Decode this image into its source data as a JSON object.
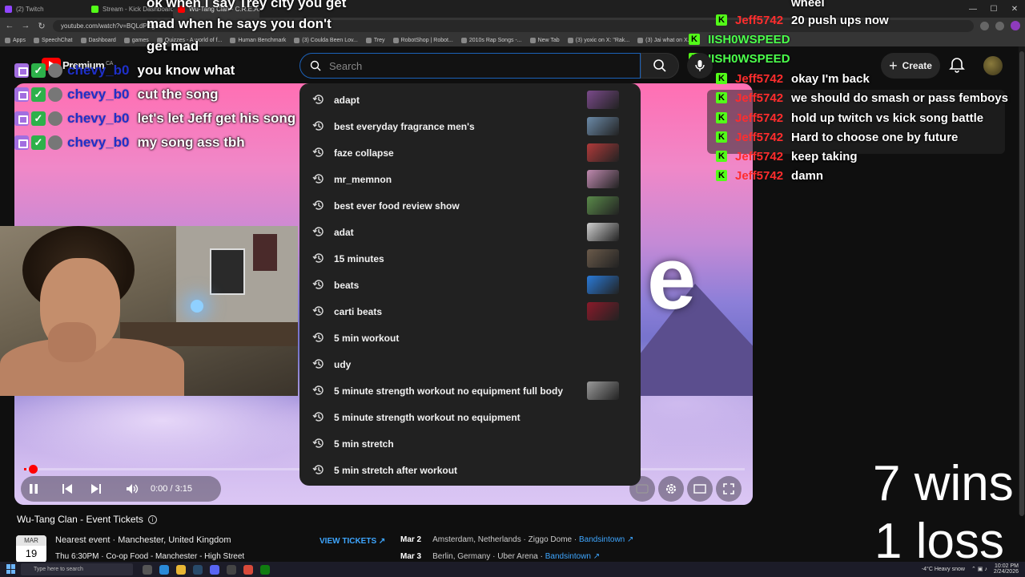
{
  "browser": {
    "tabs": [
      {
        "label": "(2) Twitch",
        "color": "#9146ff"
      },
      {
        "label": "Stream - Kick Dashboard",
        "color": "#53fc18"
      },
      {
        "label": "Wu-Tang Clan - C.R.E.A.M. (Offi",
        "color": "#ff0000",
        "active": true
      }
    ],
    "url": "youtube.com/watch?v=BQLdPEg",
    "bookmarks": [
      "Apps",
      "SpeechChat",
      "Dashboard",
      "games",
      "Quizzes - A world of f...",
      "Human Benchmark",
      "(3) Coulda Been Lov...",
      "Trey",
      "RobotShop | Robot...",
      "2010s Rap Songs -...",
      "New Tab",
      "(3) yoxic on X: \"Rak...",
      "(3) Jai what on X..."
    ]
  },
  "youtube": {
    "brand": "Premium",
    "region": "CA",
    "search_placeholder": "Search",
    "create_label": "Create",
    "suggestions": [
      {
        "text": "adapt",
        "thumb": "#7a4a8a"
      },
      {
        "text": "best everyday fragrance men's",
        "thumb": "#6b8aa8"
      },
      {
        "text": "faze collapse",
        "thumb": "#b03a3a"
      },
      {
        "text": "mr_memnon",
        "thumb": "#c08ab0"
      },
      {
        "text": "best ever food review show",
        "thumb": "#5a8a4a"
      },
      {
        "text": "adat",
        "thumb": "#cfcfcf"
      },
      {
        "text": "15 minutes",
        "thumb": "#6a5a4a"
      },
      {
        "text": "beats",
        "thumb": "#2a7ad8"
      },
      {
        "text": "carti beats",
        "thumb": "#8a1a2a"
      },
      {
        "text": "5 min workout",
        "thumb": ""
      },
      {
        "text": "udy",
        "thumb": ""
      },
      {
        "text": "5 minute strength workout no equipment full body",
        "thumb": "#9a9a9a"
      },
      {
        "text": "5 minute strength workout no equipment",
        "thumb": ""
      },
      {
        "text": "5 min stretch",
        "thumb": ""
      },
      {
        "text": "5 min stretch after workout",
        "thumb": ""
      }
    ],
    "player": {
      "time": "0:00 / 3:15",
      "progress": 0.003,
      "overlay_letter": "e"
    },
    "events": {
      "title": "Wu-Tang Clan - Event Tickets",
      "cal_month": "MAR",
      "cal_day": "19",
      "nearest": "Nearest event · Manchester, United Kingdom",
      "nearest_detail": "Thu 6:30PM · Co-op Food - Manchester - High Street",
      "view_tickets": "VIEW TICKETS ↗",
      "rows": [
        {
          "date": "Mar 2",
          "place": "Amsterdam, Netherlands · Ziggo Dome · ",
          "source": "Bandsintown ↗"
        },
        {
          "date": "Mar 3",
          "place": "Berlin, Germany · Uber Arena · ",
          "source": "Bandsintown ↗"
        }
      ]
    }
  },
  "overlay": {
    "top_messages": [
      "ok when i say Trey city you get",
      "mad when he says you don't",
      "get mad"
    ],
    "left_chat": [
      {
        "name": "chevy_b0",
        "msg": "you know what"
      },
      {
        "name": "chevy_b0",
        "msg": "cut the song"
      },
      {
        "name": "chevy_b0",
        "msg": "let's let Jeff get his song"
      },
      {
        "name": "chevy_b0",
        "msg": "my song ass tbh"
      }
    ],
    "right_chat": [
      {
        "name": "",
        "msg": "wheel",
        "type": "none"
      },
      {
        "name": "Jeff5742",
        "msg": "20 push ups now",
        "type": "jeff"
      },
      {
        "name": "IISH0WSPEED",
        "msg": "",
        "type": "speed"
      },
      {
        "name": "IISH0WSPEED",
        "msg": "",
        "type": "speed"
      },
      {
        "name": "Jeff5742",
        "msg": "okay I'm back",
        "type": "jeff"
      },
      {
        "name": "Jeff5742",
        "msg": "we should do smash or pass femboys",
        "type": "jeff"
      },
      {
        "name": "Jeff5742",
        "msg": "hold up twitch vs kick song battle",
        "type": "jeff"
      },
      {
        "name": "Jeff5742",
        "msg": "Hard to choose one by future",
        "type": "jeff"
      },
      {
        "name": "Jeff5742",
        "msg": "keep taking",
        "type": "jeff"
      },
      {
        "name": "Jeff5742",
        "msg": "damn",
        "type": "jeff"
      }
    ],
    "wins": "7 wins",
    "losses": "1 loss"
  },
  "taskbar": {
    "search_placeholder": "Type here to search",
    "weather": "-4°C  Heavy snow",
    "time": "10:02 PM",
    "date": "2/24/2026"
  },
  "colors": {
    "accent_blue": "#3ea6ff",
    "kick_green": "#53fc18",
    "youtube_red": "#ff0000"
  }
}
